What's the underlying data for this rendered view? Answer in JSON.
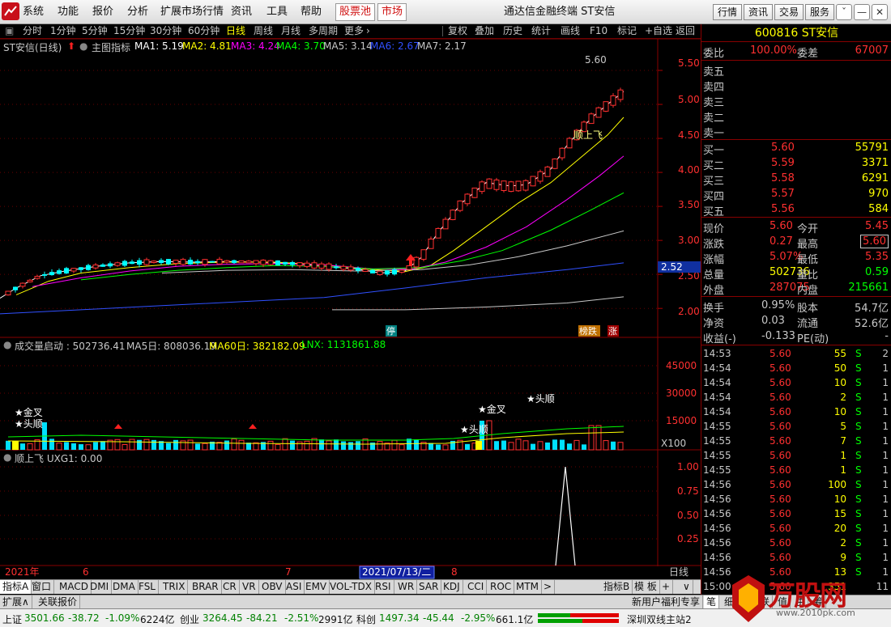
{
  "menubar": {
    "items": [
      "系统",
      "功能",
      "报价",
      "分析",
      "扩展市场行情",
      "资讯",
      "工具",
      "帮助"
    ],
    "red_items": [
      "股票池",
      "市场"
    ],
    "title": "通达信金融终端  ST安信",
    "right_buttons": [
      "行情",
      "资讯",
      "交易",
      "服务"
    ],
    "win_buttons": [
      "ˇ",
      "—",
      "□",
      "✕"
    ]
  },
  "toolbar": {
    "periods": [
      "分时",
      "1分钟",
      "5分钟",
      "15分钟",
      "30分钟",
      "60分钟",
      "日线",
      "周线",
      "月线",
      "多周期",
      "更多"
    ],
    "more_arrow": "›",
    "tools": [
      "复权",
      "叠加",
      "历史",
      "统计",
      "画线",
      "F10",
      "标记",
      "+自选",
      "返回"
    ]
  },
  "main_info": {
    "name": "ST安信(日线)",
    "indicator": "主图指标",
    "ma": [
      {
        "label": "MA1: 5.19",
        "color": "#ffffff"
      },
      {
        "label": "MA2: 4.81",
        "color": "#ffff00"
      },
      {
        "label": "MA3: 4.24",
        "color": "#ff00ff"
      },
      {
        "label": "MA4: 3.70",
        "color": "#00ff00"
      },
      {
        "label": "MA5: 3.14",
        "color": "#c8c8c8"
      },
      {
        "label": "MA6: 2.67",
        "color": "#3050ff"
      },
      {
        "label": "MA7: 2.17",
        "color": "#c8c8c8"
      }
    ]
  },
  "vol_info": {
    "label": "成交量启动 : 502736.41",
    "ma5": "MA5日: 808036.19",
    "ma60": "MA60日: 382182.09",
    "lnx": "LNX: 1131861.88"
  },
  "ind_info": {
    "label": "顺上飞  UXG1: 0.00"
  },
  "annotations": {
    "high": "5.60",
    "shunshangfei": "顺上飞",
    "cur_price": "2.52",
    "ting": "停",
    "bangdie": "榜跌",
    "zhang": "涨",
    "x100": "X100",
    "jincha": "★金叉",
    "toushun": "★头顺",
    "daily": "日线"
  },
  "y_axis": {
    "price": [
      "5.50",
      "5.00",
      "4.50",
      "4.00",
      "3.50",
      "3.00",
      "2.50",
      "2.00"
    ],
    "volume": [
      "45000",
      "30000",
      "15000"
    ],
    "indicator": [
      "1.00",
      "0.75",
      "0.50",
      "0.25"
    ]
  },
  "x_axis": {
    "labels": [
      "2021年",
      "6",
      "7",
      "8"
    ],
    "cursor": "2021/07/13/二"
  },
  "right_panel": {
    "stock_head": "600816 ST安信",
    "webi": {
      "label1": "委比",
      "value1": "100.00%",
      "label2": "委差",
      "value2": "67007"
    },
    "sells": [
      "卖五",
      "卖四",
      "卖三",
      "卖二",
      "卖一"
    ],
    "buys": [
      {
        "label": "买一",
        "price": "5.60",
        "vol": "55791"
      },
      {
        "label": "买二",
        "price": "5.59",
        "vol": "3371"
      },
      {
        "label": "买三",
        "price": "5.58",
        "vol": "6291"
      },
      {
        "label": "买四",
        "price": "5.57",
        "vol": "970"
      },
      {
        "label": "买五",
        "price": "5.56",
        "vol": "584"
      }
    ],
    "stats": [
      {
        "l1": "现价",
        "v1": "5.60",
        "c1": "#ff3030",
        "l2": "今开",
        "v2": "5.45",
        "c2": "#ff3030",
        "box2": false
      },
      {
        "l1": "涨跌",
        "v1": "0.27",
        "c1": "#ff3030",
        "l2": "最高",
        "v2": "5.60",
        "c2": "#ff3030",
        "box2": true
      },
      {
        "l1": "涨幅",
        "v1": "5.07%",
        "c1": "#ff3030",
        "l2": "最低",
        "v2": "5.35",
        "c2": "#ff3030",
        "box2": false
      },
      {
        "l1": "总量",
        "v1": "502736",
        "c1": "#ffff00",
        "l2": "量比",
        "v2": "0.59",
        "c2": "#00ff00",
        "box2": false
      },
      {
        "l1": "外盘",
        "v1": "287075",
        "c1": "#ff3030",
        "l2": "内盘",
        "v2": "215661",
        "c2": "#00ff00",
        "box2": false
      }
    ],
    "fin": [
      {
        "l1": "换手",
        "v1": "0.95%",
        "l2": "股本",
        "v2": "54.7亿"
      },
      {
        "l1": "净资",
        "v1": "0.03",
        "l2": "流通",
        "v2": "52.6亿"
      },
      {
        "l1": "收益(-)",
        "v1": "-0.133",
        "l2": "PE(动)",
        "v2": "-"
      }
    ],
    "ticks": [
      {
        "t": "14:53",
        "p": "5.60",
        "v": "55",
        "s": "S",
        "n": "2"
      },
      {
        "t": "14:54",
        "p": "5.60",
        "v": "50",
        "s": "S",
        "n": "1"
      },
      {
        "t": "14:54",
        "p": "5.60",
        "v": "10",
        "s": "S",
        "n": "1"
      },
      {
        "t": "14:54",
        "p": "5.60",
        "v": "2",
        "s": "S",
        "n": "1"
      },
      {
        "t": "14:54",
        "p": "5.60",
        "v": "10",
        "s": "S",
        "n": "1"
      },
      {
        "t": "14:55",
        "p": "5.60",
        "v": "5",
        "s": "S",
        "n": "1"
      },
      {
        "t": "14:55",
        "p": "5.60",
        "v": "7",
        "s": "S",
        "n": "1"
      },
      {
        "t": "14:55",
        "p": "5.60",
        "v": "1",
        "s": "S",
        "n": "1"
      },
      {
        "t": "14:55",
        "p": "5.60",
        "v": "1",
        "s": "S",
        "n": "1"
      },
      {
        "t": "14:56",
        "p": "5.60",
        "v": "100",
        "s": "S",
        "n": "1"
      },
      {
        "t": "14:56",
        "p": "5.60",
        "v": "10",
        "s": "S",
        "n": "1"
      },
      {
        "t": "14:56",
        "p": "5.60",
        "v": "15",
        "s": "S",
        "n": "1"
      },
      {
        "t": "14:56",
        "p": "5.60",
        "v": "20",
        "s": "S",
        "n": "1"
      },
      {
        "t": "14:56",
        "p": "5.60",
        "v": "2",
        "s": "S",
        "n": "1"
      },
      {
        "t": "14:56",
        "p": "5.60",
        "v": "9",
        "s": "S",
        "n": "1"
      },
      {
        "t": "14:56",
        "p": "5.60",
        "v": "13",
        "s": "S",
        "n": "1"
      },
      {
        "t": "15:00",
        "p": "5.60",
        "v": "351",
        "s": "",
        "n": "11"
      }
    ]
  },
  "bottom_tabs": [
    "指标A",
    "窗口",
    "MACD",
    "DMI",
    "DMA",
    "FSL",
    "TRIX",
    "BRAR",
    "CR",
    "VR",
    "OBV",
    "ASI",
    "EMV",
    "VOL-TDX",
    "RSI",
    "WR",
    "SAR",
    "KDJ",
    "CCI",
    "ROC",
    "MTM",
    ">"
  ],
  "bottom_right": [
    "指标B",
    "模 板",
    "+",
    "∨"
  ],
  "bottom_tabs2": [
    "扩展∧",
    "关联报价"
  ],
  "bottom_tabs2_right": [
    "新用户福利专享",
    "笔",
    "细",
    "势",
    "联",
    "值",
    "主",
    "筹"
  ],
  "statusbar": {
    "sh_label": "上证",
    "sh_val": "3501.66",
    "sh_chg": "-38.72",
    "sh_pct": "-1.09%",
    "sh_amt": "6224亿",
    "cy_label": "创业",
    "cy_val": "3264.45",
    "cy_chg": "-84.21",
    "cy_pct": "-2.51%",
    "cy_amt": "2991亿",
    "kc_label": "科创",
    "kc_val": "1497.34",
    "kc_chg": "-45.44",
    "kc_pct": "-2.95%",
    "kc_amt": "661.1亿",
    "server": "深圳双线主站2"
  },
  "watermark": {
    "text": "万股网",
    "url": "www.2010pk.com"
  },
  "chart_data": {
    "type": "candlestick",
    "series": [
      {
        "name": "MA1: 5.19",
        "color": "#ffffff",
        "points": [
          [
            0,
            2.15
          ],
          [
            20,
            2.3
          ],
          [
            50,
            2.48
          ],
          [
            80,
            2.55
          ],
          [
            120,
            2.62
          ],
          [
            160,
            2.67
          ],
          [
            200,
            2.69
          ],
          [
            240,
            2.68
          ],
          [
            280,
            2.69
          ],
          [
            320,
            2.68
          ],
          [
            360,
            2.66
          ],
          [
            400,
            2.62
          ],
          [
            440,
            2.58
          ],
          [
            470,
            2.52
          ],
          [
            500,
            2.55
          ],
          [
            520,
            2.75
          ],
          [
            540,
            3.1
          ],
          [
            570,
            3.55
          ],
          [
            600,
            3.85
          ],
          [
            630,
            3.8
          ],
          [
            650,
            3.82
          ],
          [
            680,
            4.05
          ],
          [
            700,
            4.4
          ],
          [
            730,
            4.8
          ],
          [
            750,
            5.0
          ],
          [
            770,
            5.19
          ]
        ]
      },
      {
        "name": "MA2: 4.81",
        "color": "#ffff00",
        "points": [
          [
            20,
            2.2
          ],
          [
            60,
            2.4
          ],
          [
            100,
            2.52
          ],
          [
            160,
            2.6
          ],
          [
            220,
            2.66
          ],
          [
            280,
            2.68
          ],
          [
            340,
            2.68
          ],
          [
            400,
            2.64
          ],
          [
            450,
            2.58
          ],
          [
            500,
            2.54
          ],
          [
            530,
            2.62
          ],
          [
            560,
            2.85
          ],
          [
            600,
            3.2
          ],
          [
            640,
            3.55
          ],
          [
            680,
            3.85
          ],
          [
            720,
            4.25
          ],
          [
            750,
            4.55
          ],
          [
            770,
            4.81
          ]
        ]
      },
      {
        "name": "MA3: 4.24",
        "color": "#ff00ff",
        "points": [
          [
            40,
            2.32
          ],
          [
            100,
            2.45
          ],
          [
            160,
            2.55
          ],
          [
            220,
            2.62
          ],
          [
            280,
            2.65
          ],
          [
            340,
            2.66
          ],
          [
            400,
            2.64
          ],
          [
            460,
            2.58
          ],
          [
            510,
            2.58
          ],
          [
            550,
            2.68
          ],
          [
            600,
            2.9
          ],
          [
            650,
            3.2
          ],
          [
            700,
            3.6
          ],
          [
            740,
            3.95
          ],
          [
            770,
            4.24
          ]
        ]
      },
      {
        "name": "MA4: 3.70",
        "color": "#00ff00",
        "points": [
          [
            100,
            2.42
          ],
          [
            160,
            2.5
          ],
          [
            220,
            2.56
          ],
          [
            280,
            2.6
          ],
          [
            340,
            2.63
          ],
          [
            400,
            2.62
          ],
          [
            460,
            2.58
          ],
          [
            520,
            2.6
          ],
          [
            570,
            2.7
          ],
          [
            620,
            2.85
          ],
          [
            680,
            3.15
          ],
          [
            730,
            3.45
          ],
          [
            770,
            3.7
          ]
        ]
      },
      {
        "name": "MA5: 3.14",
        "color": "#c8c8c8",
        "points": [
          [
            200,
            2.52
          ],
          [
            280,
            2.56
          ],
          [
            360,
            2.57
          ],
          [
            440,
            2.55
          ],
          [
            520,
            2.57
          ],
          [
            580,
            2.64
          ],
          [
            640,
            2.76
          ],
          [
            700,
            2.92
          ],
          [
            770,
            3.14
          ]
        ]
      },
      {
        "name": "MA6: 2.67",
        "color": "#3050ff",
        "points": [
          [
            0,
            1.92
          ],
          [
            100,
            1.98
          ],
          [
            200,
            2.04
          ],
          [
            300,
            2.1
          ],
          [
            400,
            2.16
          ],
          [
            500,
            2.3
          ],
          [
            600,
            2.45
          ],
          [
            700,
            2.57
          ],
          [
            770,
            2.67
          ]
        ]
      },
      {
        "name": "MA7: 2.17",
        "color": "#c8c8c8",
        "points": [
          [
            410,
            1.98
          ],
          [
            500,
            1.98
          ],
          [
            600,
            2.02
          ],
          [
            700,
            2.08
          ],
          [
            770,
            2.17
          ]
        ]
      }
    ],
    "ylim": [
      1.8,
      5.75
    ]
  }
}
